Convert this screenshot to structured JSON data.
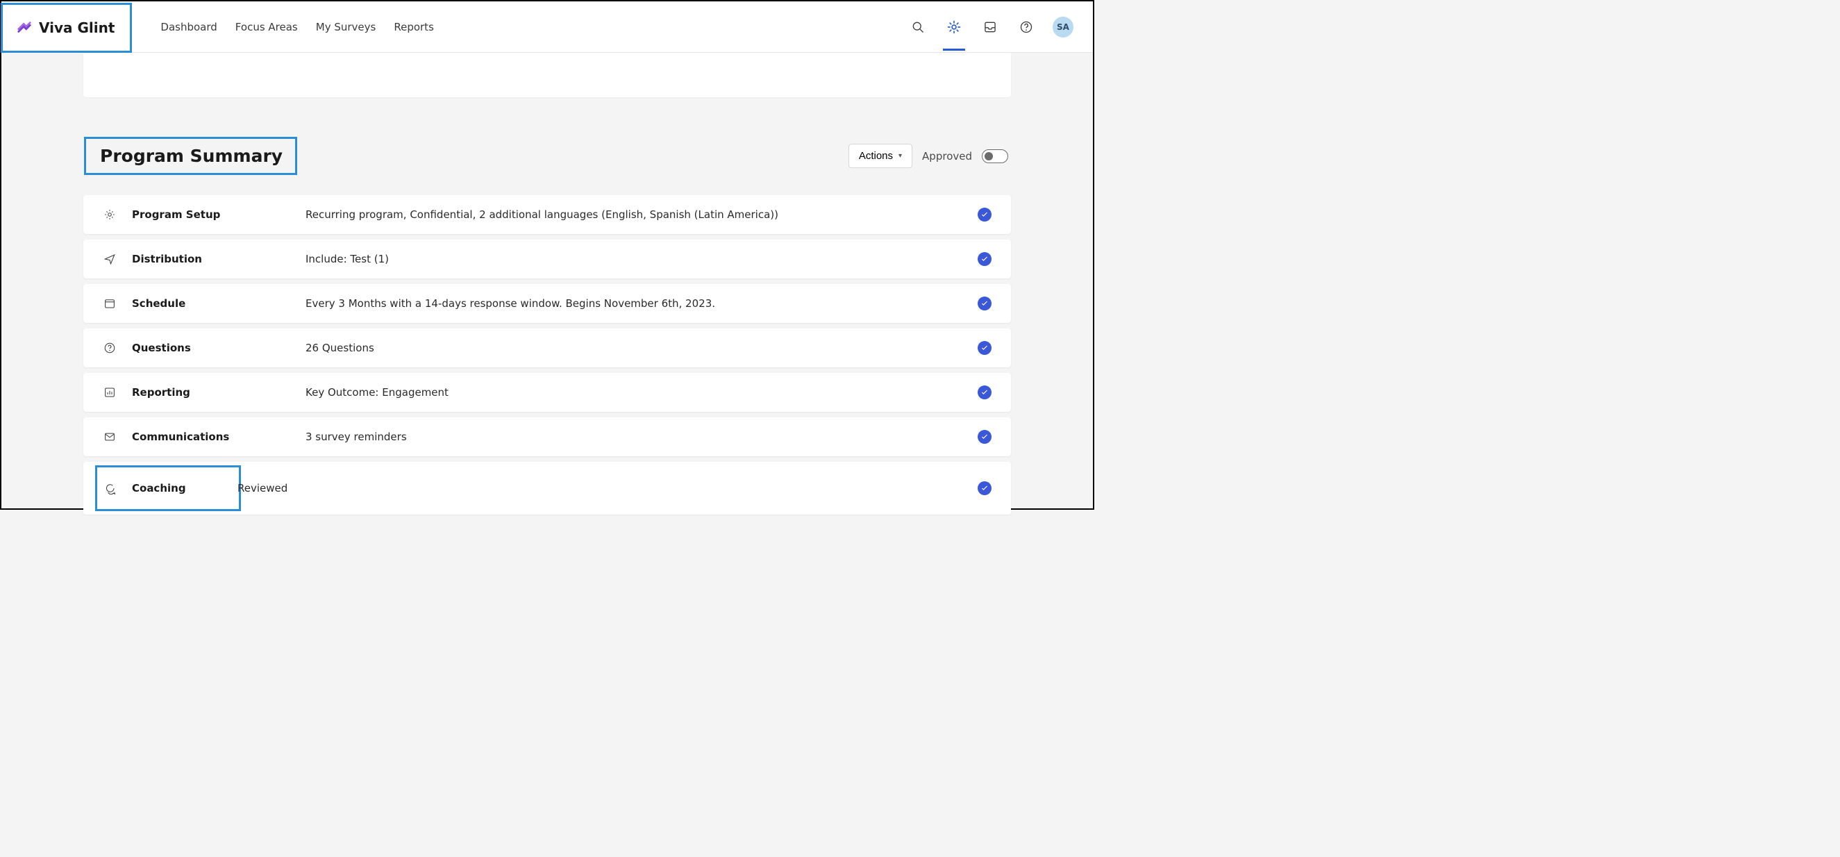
{
  "brand": {
    "name": "Viva Glint"
  },
  "nav": {
    "items": [
      {
        "label": "Dashboard"
      },
      {
        "label": "Focus Areas"
      },
      {
        "label": "My Surveys"
      },
      {
        "label": "Reports"
      }
    ]
  },
  "user": {
    "initials": "SA"
  },
  "section": {
    "title": "Program Summary",
    "actions_label": "Actions",
    "approved_label": "Approved"
  },
  "summary": [
    {
      "icon": "gear",
      "label": "Program Setup",
      "desc": "Recurring program, Confidential, 2 additional languages (English, Spanish (Latin America))"
    },
    {
      "icon": "send",
      "label": "Distribution",
      "desc": "Include: Test (1)"
    },
    {
      "icon": "calendar",
      "label": "Schedule",
      "desc": "Every 3 Months with a 14-days response window. Begins November 6th, 2023."
    },
    {
      "icon": "question",
      "label": "Questions",
      "desc": "26 Questions"
    },
    {
      "icon": "chart",
      "label": "Reporting",
      "desc": "Key Outcome: Engagement"
    },
    {
      "icon": "mail",
      "label": "Communications",
      "desc": "3 survey reminders"
    },
    {
      "icon": "chat",
      "label": "Coaching",
      "desc": "Reviewed"
    }
  ]
}
